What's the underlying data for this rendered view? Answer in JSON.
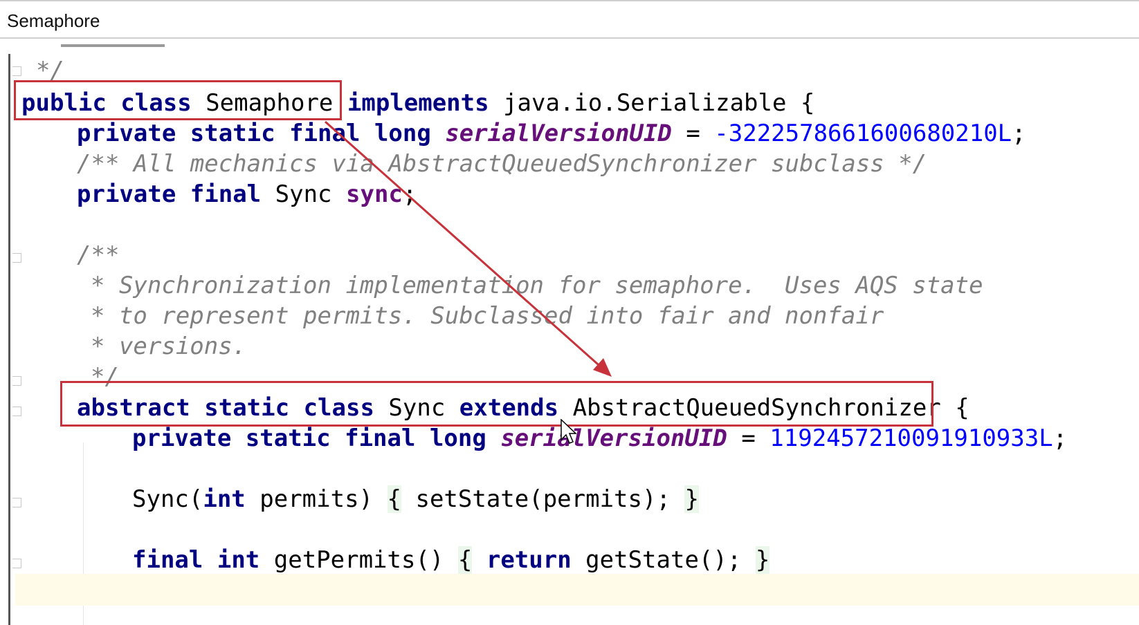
{
  "window": {
    "title": "Semaphore"
  },
  "code": {
    "line1": "*/",
    "line2": {
      "kw1": "public",
      "kw2": "class",
      "name": "Semaphore",
      "kw3": "implements",
      "rest": "java.io.Serializable {"
    },
    "line3": {
      "kw1": "private",
      "kw2": "static",
      "kw3": "final",
      "kw4": "long",
      "field": "serialVersionUID",
      "eq": "=",
      "value": "-3222578661600680210L",
      "semi": ";"
    },
    "line4": "/** All mechanics via AbstractQueuedSynchronizer subclass */",
    "line5": {
      "kw1": "private",
      "kw2": "final",
      "type": "Sync",
      "field": "sync",
      "semi": ";"
    },
    "line6": "/**",
    "line7": "* Synchronization implementation for semaphore.  Uses AQS state",
    "line8": "* to represent permits. Subclassed into fair and nonfair",
    "line9": "* versions.",
    "line10": "*/",
    "line11": {
      "kw1": "abstract",
      "kw2": "static",
      "kw3": "class",
      "name": "Sync",
      "kw4": "extends",
      "parent": "AbstractQueuedSynchronizer",
      "brace": "{"
    },
    "line12": {
      "kw1": "private",
      "kw2": "static",
      "kw3": "final",
      "kw4": "long",
      "field": "serialVersionUID",
      "eq": "=",
      "value": "1192457210091910933L",
      "semi": ";"
    },
    "line13": {
      "name": "Sync(",
      "kw": "int",
      "arg": "permits)",
      "open": "{",
      "body": "setState(permits);",
      "close": "}"
    },
    "line14": {
      "kw1": "final",
      "kw2": "int",
      "name": "getPermits()",
      "open": "{",
      "kw3": "return",
      "body": "getState();",
      "close": "}"
    }
  },
  "annotations": {
    "color": "#c8323a"
  }
}
